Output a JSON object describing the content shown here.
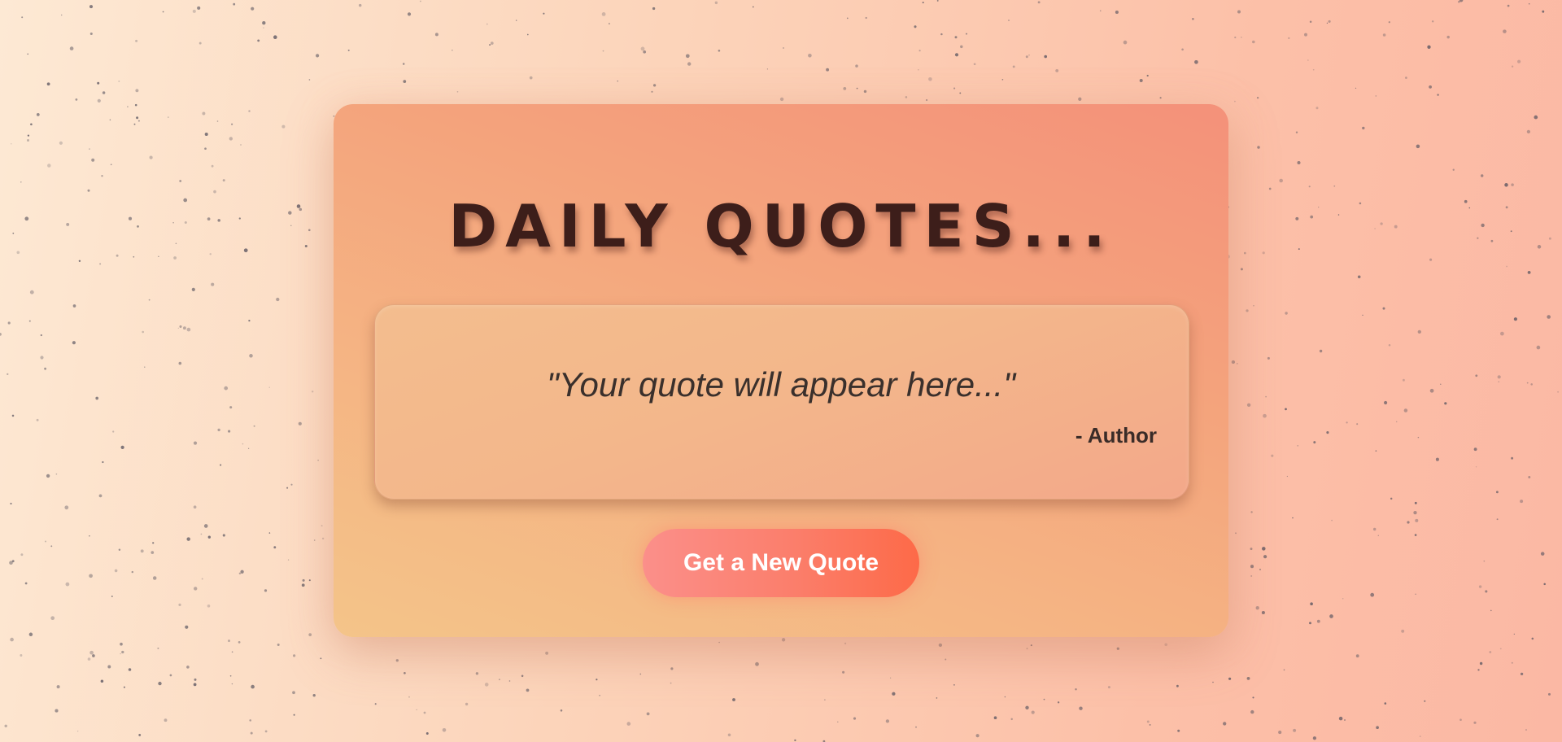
{
  "page": {
    "title": "DAILY QUOTES..."
  },
  "quote": {
    "text": "\"Your quote will appear here...\"",
    "author": "- Author"
  },
  "actions": {
    "new_quote_label": "Get a New Quote"
  },
  "colors": {
    "title": "#3d1e1a",
    "button_start": "#fb8f8a",
    "button_end": "#fd6a48",
    "card_accent": "#f4a37c"
  }
}
